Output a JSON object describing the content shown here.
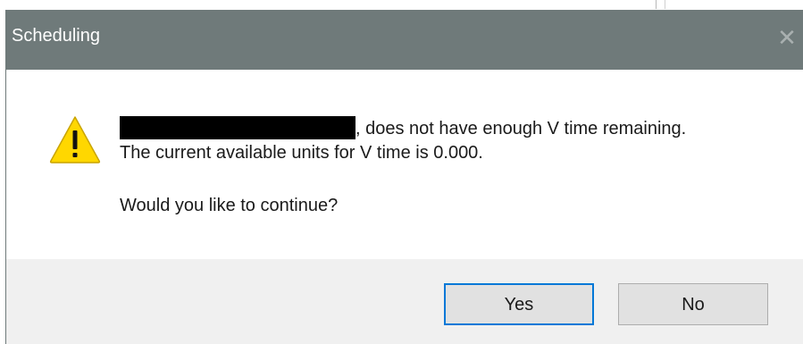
{
  "dialog": {
    "title": "Scheduling",
    "close_glyph": "✕",
    "icon": "warning-icon",
    "message_line1_suffix": ", does not have enough V time remaining.",
    "message_line2": "The current available units for V time is 0.000.",
    "message_line3": "Would you like to continue?",
    "buttons": {
      "yes_label": "Yes",
      "no_label": "No"
    }
  },
  "colors": {
    "titlebar": "#6f7a7a",
    "footer": "#f0f0f0",
    "default_button_border": "#0078d7",
    "warning_fill": "#ffd700"
  }
}
